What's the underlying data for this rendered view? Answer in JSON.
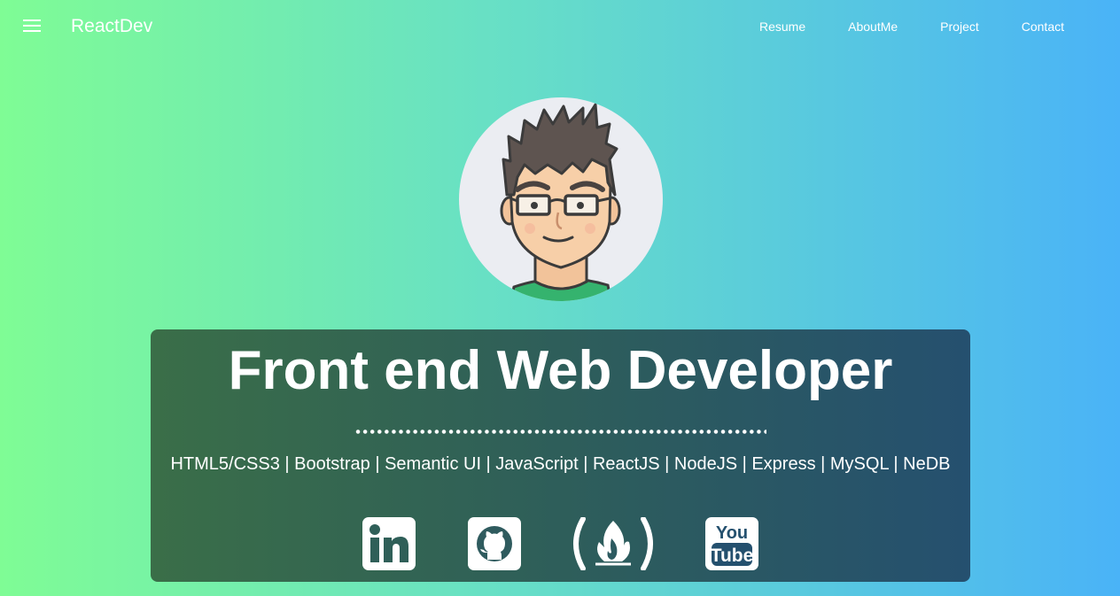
{
  "header": {
    "brand": "ReactDev",
    "menu_icon": "hamburger-menu-icon",
    "nav": [
      {
        "label": "Resume"
      },
      {
        "label": "AboutMe"
      },
      {
        "label": "Project"
      },
      {
        "label": "Contact"
      }
    ]
  },
  "hero": {
    "avatar_icon": "developer-avatar",
    "headline": "Front end Web Developer",
    "skills": "HTML5/CSS3 | Bootstrap | Semantic UI | JavaScript | ReactJS | NodeJS | Express | MySQL | NeDB",
    "social": [
      {
        "icon": "linkedin-icon"
      },
      {
        "icon": "github-icon"
      },
      {
        "icon": "freecodecamp-icon"
      },
      {
        "icon": "youtube-icon"
      }
    ]
  },
  "colors": {
    "gradient_start": "#7ffc95",
    "gradient_end": "#4ab3f7",
    "card_start": "#3a6e48",
    "card_end": "#25506f",
    "text": "#ffffff"
  }
}
